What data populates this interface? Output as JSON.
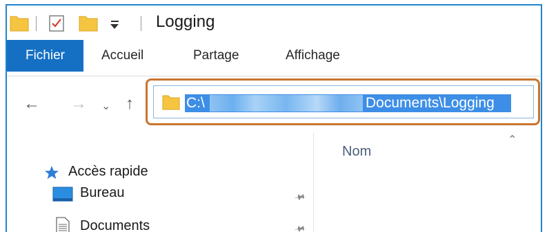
{
  "window": {
    "title": "Logging"
  },
  "ribbon": {
    "tabs": [
      {
        "label": "Fichier",
        "active": true
      },
      {
        "label": "Accueil",
        "active": false
      },
      {
        "label": "Partage",
        "active": false
      },
      {
        "label": "Affichage",
        "active": false
      }
    ]
  },
  "address_bar": {
    "prefix": "C:\\",
    "suffix": "Documents\\Logging",
    "selected": true,
    "highlight_color": "#c9742e",
    "selection_color": "#3d8ee6"
  },
  "file_list": {
    "column_name": "Nom"
  },
  "nav_pane": {
    "quick_access": "Accès rapide",
    "items": [
      {
        "label": "Bureau",
        "icon": "desktop-icon",
        "pinned": true
      },
      {
        "label": "Documents",
        "icon": "documents-icon",
        "pinned": true
      }
    ]
  },
  "colors": {
    "accent": "#1570c4",
    "frame": "#1f83cf",
    "folder": "#f5c542"
  }
}
